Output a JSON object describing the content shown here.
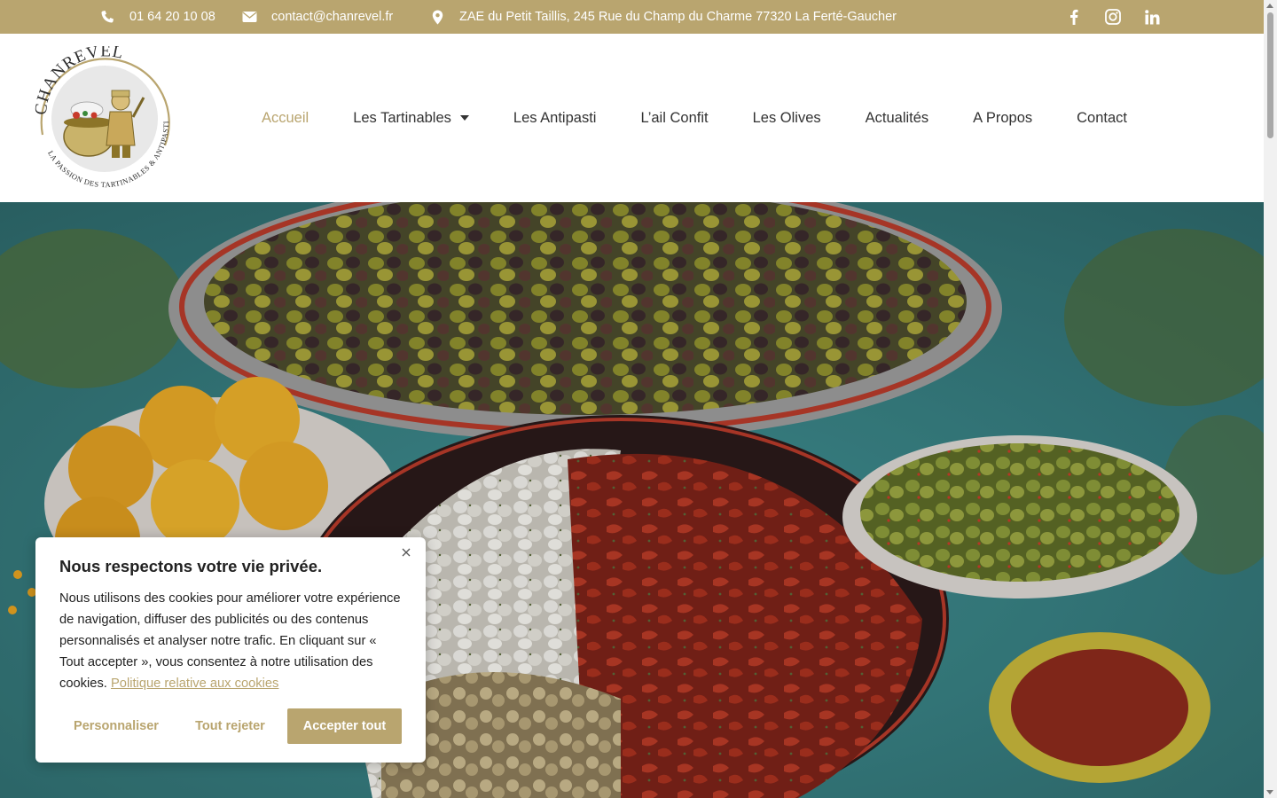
{
  "topbar": {
    "phone": "01 64 20 10 08",
    "email": "contact@chanrevel.fr",
    "address": "ZAE du Petit Taillis, 245 Rue du Champ du Charme 77320 La Ferté-Gaucher",
    "socials": [
      "facebook-icon",
      "instagram-icon",
      "linkedin-icon"
    ],
    "bg_color": "#b9a56f"
  },
  "logo": {
    "brand": "CHANREVEL",
    "tagline": "LA PASSION DES TARTINABLES & ANTIPASTI"
  },
  "nav": {
    "items": [
      {
        "label": "Accueil",
        "active": true
      },
      {
        "label": "Les Tartinables",
        "dropdown": true
      },
      {
        "label": "Les Antipasti"
      },
      {
        "label": "L’ail Confit"
      },
      {
        "label": "Les Olives"
      },
      {
        "label": "Actualités"
      },
      {
        "label": "A Propos"
      },
      {
        "label": "Contact"
      }
    ],
    "accent_color": "#b9a56f"
  },
  "cookie": {
    "title": "Nous respectons votre vie privée.",
    "body": "Nous utilisons des cookies pour améliorer votre expérience de navigation, diffuser des publicités ou des contenus personnalisés et analyser notre trafic. En cliquant sur « Tout accepter », vous consentez à notre utilisation des cookies.",
    "policy_link": "Politique relative aux cookies",
    "btn_customize": "Personnaliser",
    "btn_reject": "Tout rejeter",
    "btn_accept": "Accepter tout"
  }
}
